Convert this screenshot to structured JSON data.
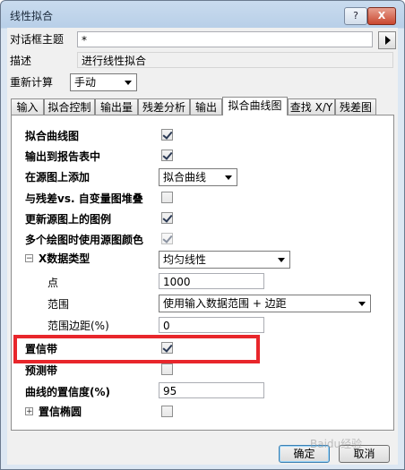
{
  "window": {
    "title": "线性拟合",
    "help_label": "?",
    "close_label": "X"
  },
  "header": {
    "theme_label": "对话框主题",
    "theme_value": "*",
    "desc_label": "描述",
    "desc_value": "进行线性拟合",
    "recalc_label": "重新计算",
    "recalc_value": "手动"
  },
  "tabs": [
    {
      "label": "输入"
    },
    {
      "label": "拟合控制"
    },
    {
      "label": "输出量"
    },
    {
      "label": "残差分析"
    },
    {
      "label": "输出"
    },
    {
      "label": "拟合曲线图"
    },
    {
      "label": "查找 X/Y"
    },
    {
      "label": "残差图"
    }
  ],
  "active_tab": "拟合曲线图",
  "options": {
    "plot_fit_curve": {
      "label": "拟合曲线图",
      "checked": true
    },
    "output_to_report": {
      "label": "输出到报告表中",
      "checked": true
    },
    "add_on_source": {
      "label": "在源图上添加",
      "value": "拟合曲线"
    },
    "residual_stack": {
      "label": "与残差vs. 自变量图堆叠",
      "checked": false
    },
    "update_legend": {
      "label": "更新源图上的图例",
      "checked": true
    },
    "multi_plot_color": {
      "label": "多个绘图时使用源图颜色",
      "checked": true
    },
    "x_data_type": {
      "label": "X数据类型",
      "value": "均匀线性",
      "expander": "−"
    },
    "points": {
      "label": "点",
      "value": "1000"
    },
    "range": {
      "label": "范围",
      "value": "使用输入数据范围 + 边距"
    },
    "range_margin": {
      "label": "范围边距(%)",
      "value": "0"
    },
    "confidence_band": {
      "label": "置信带",
      "checked": true
    },
    "prediction_band": {
      "label": "预测带",
      "checked": false
    },
    "confidence_level": {
      "label": "曲线的置信度(%)",
      "value": "95"
    },
    "confidence_ellipse": {
      "label": "置信椭圆",
      "checked": false,
      "expander": "+"
    }
  },
  "buttons": {
    "ok": "确定",
    "cancel": "取消"
  },
  "watermark": "Baidu经验"
}
